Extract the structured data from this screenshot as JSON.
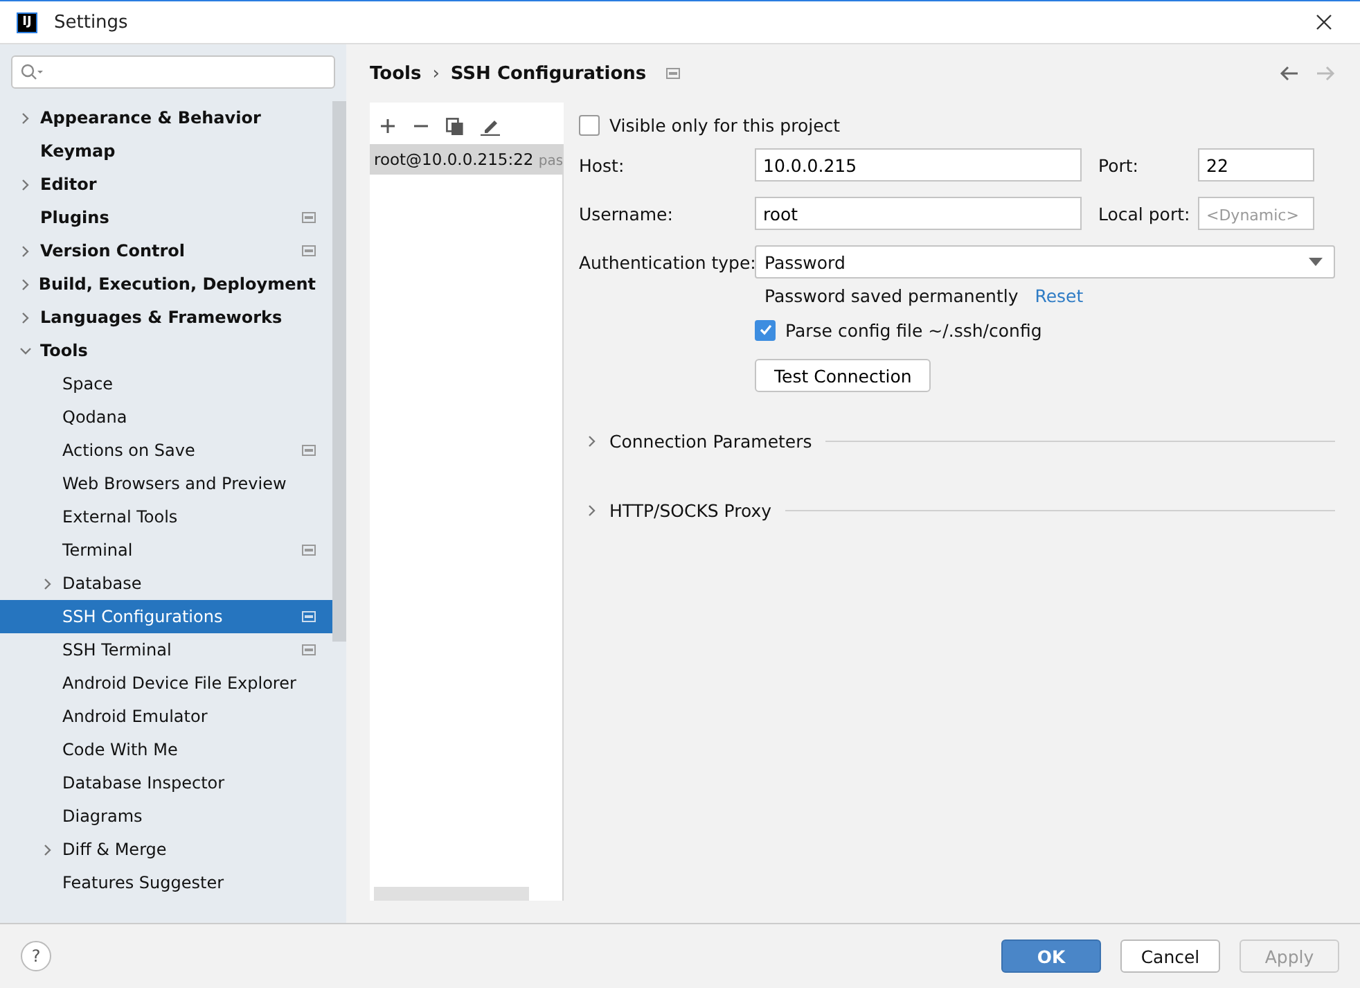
{
  "window": {
    "title": "Settings",
    "app_badge": "IJ"
  },
  "sidebar": {
    "items": [
      {
        "label": "Appearance & Behavior",
        "expanded": false,
        "project_scope": false,
        "selected": false
      },
      {
        "label": "Keymap",
        "project_scope": false,
        "selected": false
      },
      {
        "label": "Editor",
        "expanded": false,
        "project_scope": false,
        "selected": false
      },
      {
        "label": "Plugins",
        "project_scope": true,
        "selected": false
      },
      {
        "label": "Version Control",
        "expanded": false,
        "project_scope": true,
        "selected": false
      },
      {
        "label": "Build, Execution, Deployment",
        "expanded": false,
        "project_scope": false,
        "selected": false
      },
      {
        "label": "Languages & Frameworks",
        "expanded": false,
        "project_scope": false,
        "selected": false
      },
      {
        "label": "Tools",
        "expanded": true,
        "project_scope": false,
        "selected": false,
        "children": [
          {
            "label": "Space",
            "project_scope": false,
            "selected": false
          },
          {
            "label": "Qodana",
            "project_scope": false,
            "selected": false
          },
          {
            "label": "Actions on Save",
            "project_scope": true,
            "selected": false
          },
          {
            "label": "Web Browsers and Preview",
            "project_scope": false,
            "selected": false
          },
          {
            "label": "External Tools",
            "project_scope": false,
            "selected": false
          },
          {
            "label": "Terminal",
            "project_scope": true,
            "selected": false
          },
          {
            "label": "Database",
            "expanded": false,
            "project_scope": false,
            "selected": false
          },
          {
            "label": "SSH Configurations",
            "project_scope": true,
            "selected": true
          },
          {
            "label": "SSH Terminal",
            "project_scope": true,
            "selected": false
          },
          {
            "label": "Android Device File Explorer",
            "project_scope": false,
            "selected": false
          },
          {
            "label": "Android Emulator",
            "project_scope": false,
            "selected": false
          },
          {
            "label": "Code With Me",
            "project_scope": false,
            "selected": false
          },
          {
            "label": "Database Inspector",
            "project_scope": false,
            "selected": false
          },
          {
            "label": "Diagrams",
            "project_scope": false,
            "selected": false
          },
          {
            "label": "Diff & Merge",
            "expanded": false,
            "project_scope": false,
            "selected": false
          },
          {
            "label": "Features Suggester",
            "project_scope": false,
            "selected": false
          }
        ]
      }
    ]
  },
  "breadcrumb": [
    "Tools",
    "SSH Configurations"
  ],
  "breadcrumb_separator": "›",
  "navigation": {
    "back_enabled": true,
    "forward_enabled": false
  },
  "configurations": [
    {
      "name": "root@10.0.0.215:22",
      "detail": "pas",
      "selected": true
    }
  ],
  "form": {
    "visible_only_for_project": {
      "label": "Visible only for this project",
      "checked": false
    },
    "host": {
      "label": "Host:",
      "value": "10.0.0.215"
    },
    "port": {
      "label": "Port:",
      "value": "22"
    },
    "username": {
      "label": "Username:",
      "value": "root"
    },
    "local_port": {
      "label": "Local port:",
      "placeholder": "<Dynamic>"
    },
    "auth_type": {
      "label": "Authentication type:",
      "value": "Password"
    },
    "password_note": "Password saved permanently",
    "reset_link": "Reset",
    "parse_config": {
      "label": "Parse config file ~/.ssh/config",
      "checked": true
    },
    "test_button": "Test Connection",
    "sections": [
      {
        "label": "Connection Parameters",
        "expanded": false
      },
      {
        "label": "HTTP/SOCKS Proxy",
        "expanded": false
      }
    ]
  },
  "footer": {
    "help": "?",
    "buttons": [
      {
        "label": "OK",
        "kind": "primary",
        "disabled": false
      },
      {
        "label": "Cancel",
        "kind": "normal",
        "disabled": false
      },
      {
        "label": "Apply",
        "kind": "normal",
        "disabled": true
      }
    ]
  }
}
